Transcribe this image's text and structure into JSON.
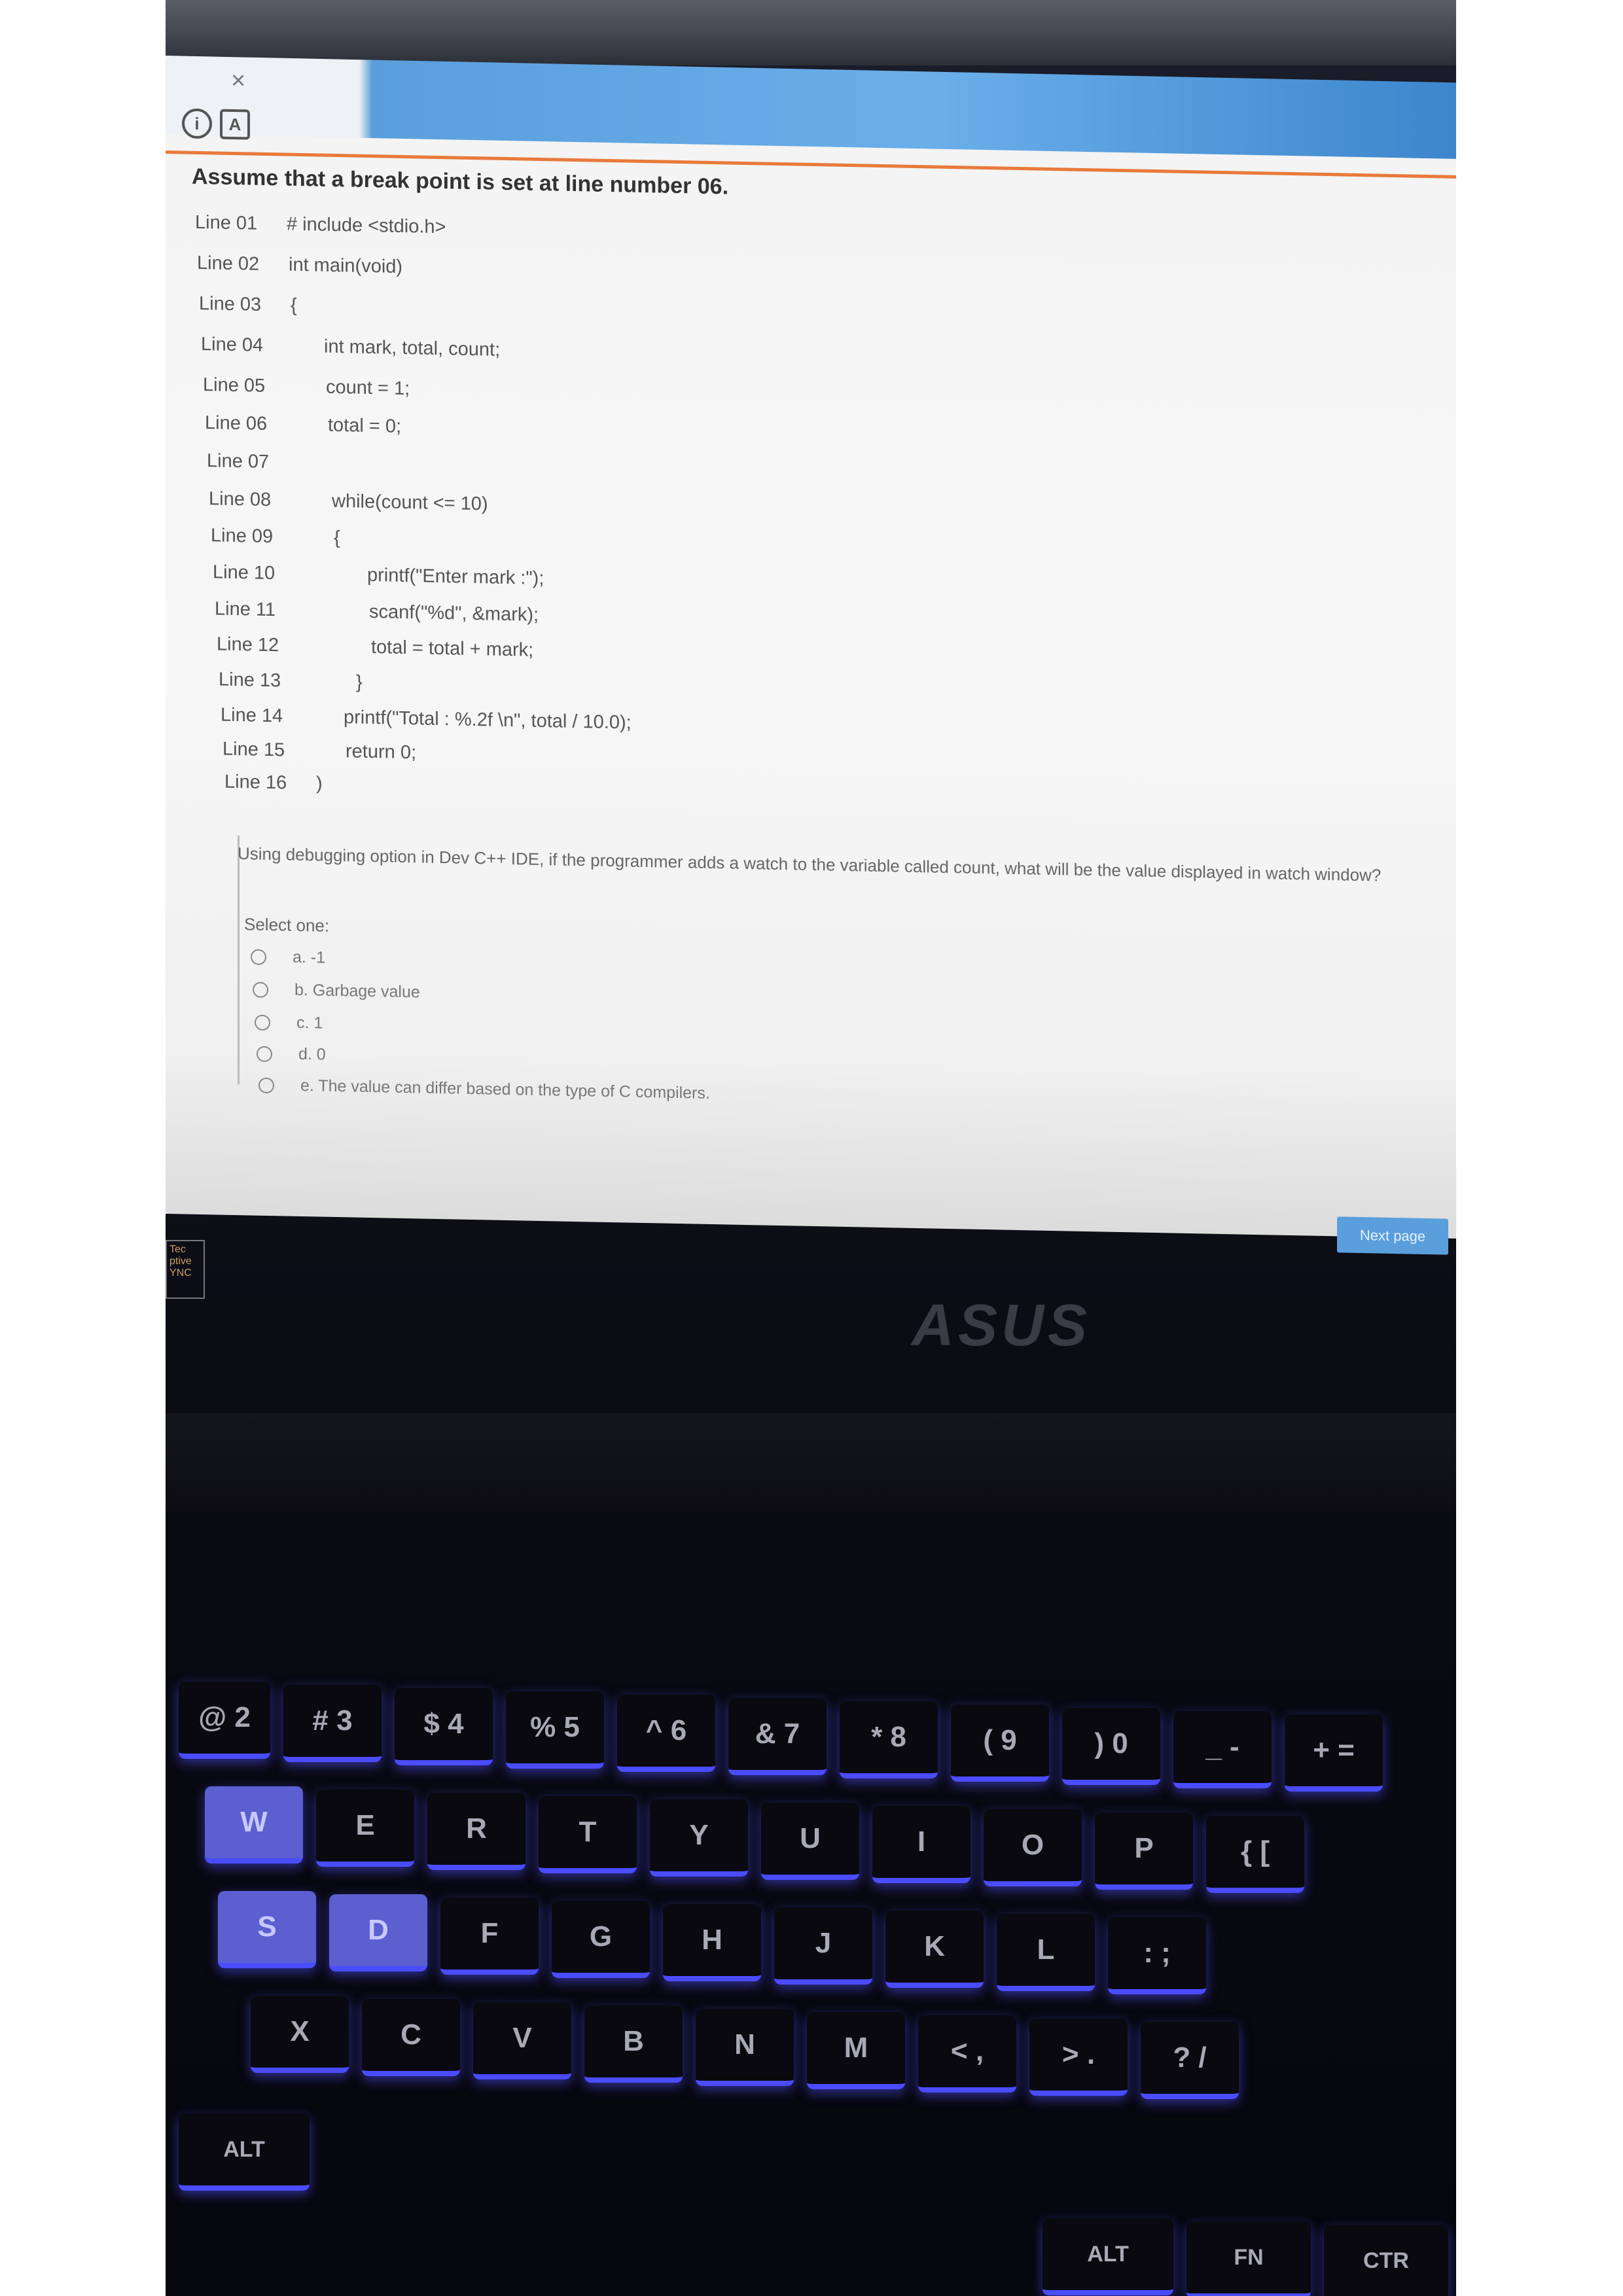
{
  "tab": {
    "close_glyph": "×"
  },
  "toolbar": {
    "info_icon": "info-icon",
    "doc_icon": "document-icon"
  },
  "question": {
    "heading": "Assume that a break point is set at line number 06.",
    "code": [
      {
        "ln": "Line 01",
        "code": "# include <stdio.h>"
      },
      {
        "ln": "Line 02",
        "code": "int main(void)"
      },
      {
        "ln": "Line 03",
        "code": "{"
      },
      {
        "ln": "Line 04",
        "code": "int mark, total, count;"
      },
      {
        "ln": "Line 05",
        "code": "count = 1;"
      },
      {
        "ln": "Line 06",
        "code": "total = 0;"
      },
      {
        "ln": "Line 07",
        "code": ""
      },
      {
        "ln": "Line 08",
        "code": "while(count <= 10)"
      },
      {
        "ln": "Line 09",
        "code": "{"
      },
      {
        "ln": "Line 10",
        "code": "printf(\"Enter mark :\");"
      },
      {
        "ln": "Line 11",
        "code": "scanf(\"%d\", &mark);"
      },
      {
        "ln": "Line 12",
        "code": "total = total + mark;"
      },
      {
        "ln": "Line 13",
        "code": "}"
      },
      {
        "ln": "Line 14",
        "code": "printf(\"Total : %.2f \\n\", total / 10.0);"
      },
      {
        "ln": "Line 15",
        "code": "return 0;"
      },
      {
        "ln": "Line 16",
        "code": ")"
      }
    ],
    "prompt": "Using debugging option in Dev C++ IDE, if the programmer adds a watch to the variable called count, what will be the value displayed in watch window?",
    "select_label": "Select one:",
    "options": [
      "a. -1",
      "b. Garbage value",
      "c. 1",
      "d. 0",
      "e. The value can differ based on the type of C compilers."
    ],
    "next_label": "Next page"
  },
  "laptop": {
    "side_label": "Tec ptive YNC",
    "brand": "ASUS",
    "keys": {
      "row_num": [
        "@ 2",
        "# 3",
        "$ 4",
        "% 5",
        "^ 6",
        "& 7",
        "* 8",
        "( 9",
        ") 0",
        "_ -",
        "+ ="
      ],
      "row_top": [
        "W",
        "E",
        "R",
        "T",
        "Y",
        "U",
        "I",
        "O",
        "P",
        "{ ["
      ],
      "row_home": [
        "S",
        "D",
        "F",
        "G",
        "H",
        "J",
        "K",
        "L",
        ": ;"
      ],
      "row_bottom": [
        "X",
        "C",
        "V",
        "B",
        "N",
        "M",
        "< ,",
        "> .",
        "? /"
      ],
      "row_mod": [
        "ALT",
        "ALT",
        "FN",
        "CTR"
      ]
    }
  }
}
